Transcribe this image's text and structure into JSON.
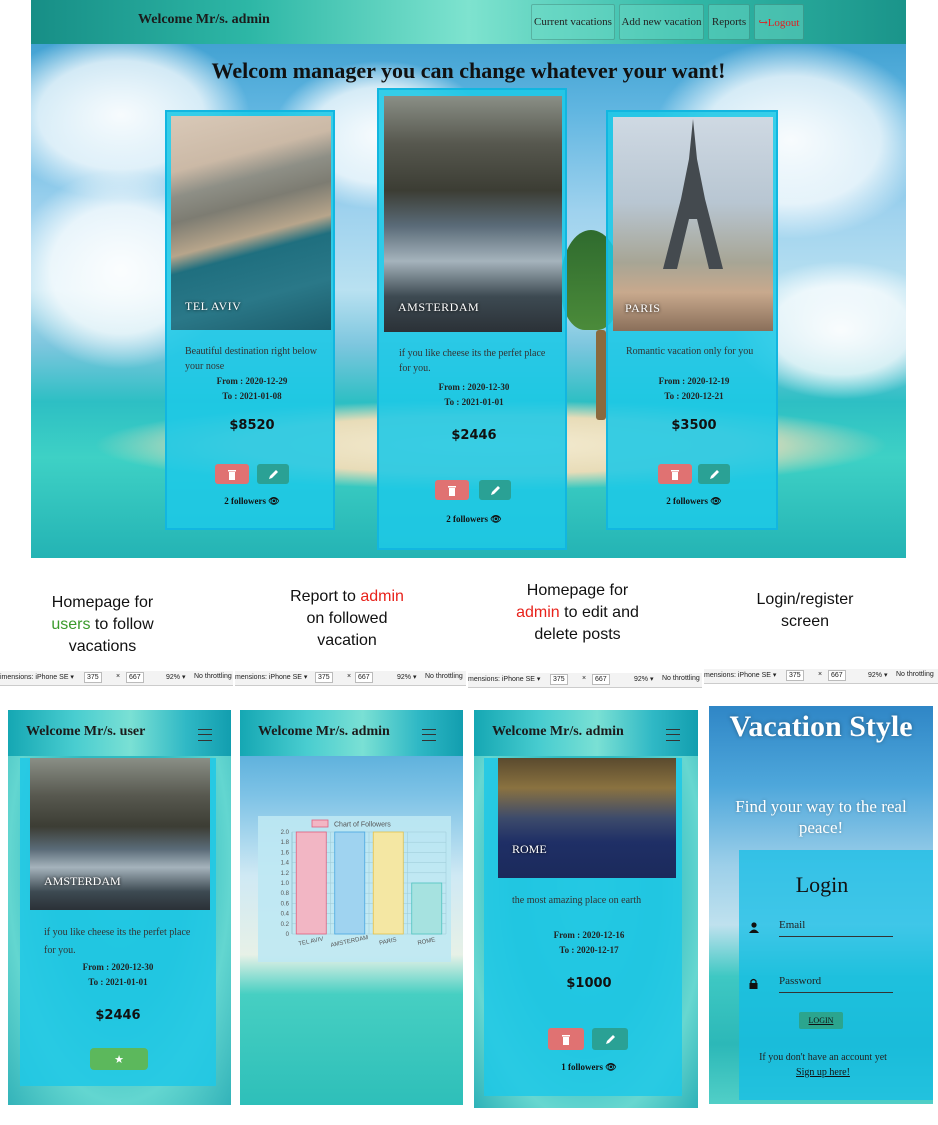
{
  "desktop": {
    "nav": {
      "welcome": "Welcome Mr/s. admin",
      "current_vacations": "Current vacations",
      "add_new_vacation": "Add new vacation",
      "reports": "Reports",
      "logout": "↪Logout"
    },
    "title": "Welcom manager you can change whatever your want!",
    "cards": [
      {
        "place": "TEL AVIV",
        "desc": "Beautiful destination right below your nose",
        "from": "From : 2020-12-29",
        "to": "To : 2021-01-08",
        "price": "$8520",
        "followers": "2 followers 👁"
      },
      {
        "place": "AMSTERDAM",
        "desc": "if you like cheese its the perfet place for you.",
        "from": "From : 2020-12-30",
        "to": "To : 2021-01-01",
        "price": "$2446",
        "followers": "2 followers 👁"
      },
      {
        "place": "PARIS",
        "desc": "Romantic vacation only for you",
        "from": "From : 2020-12-19",
        "to": "To : 2020-12-21",
        "price": "$3500",
        "followers": "2 followers 👁"
      }
    ]
  },
  "captions": {
    "c1_a": "Homepage for",
    "c1_b": "users",
    "c1_c": " to follow",
    "c1_d": "vacations",
    "c2_a": "Report to ",
    "c2_b": "admin",
    "c2_c": "on followed",
    "c2_d": "vacation",
    "c3_a": "Homepage for",
    "c3_b": "admin",
    "c3_c": " to edit and",
    "c3_d": "delete posts",
    "c4_a": "Login/register",
    "c4_b": "screen"
  },
  "devtools": {
    "dim_label": "imensions: iPhone SE ▾",
    "dim_label_alt": "mensions: iPhone SE ▾",
    "width": "375",
    "times": "×",
    "height": "667",
    "zoom": "92% ▾",
    "throttle": "No throttling"
  },
  "mobile_user": {
    "welcome": "Welcome Mr/s. user",
    "place": "AMSTERDAM",
    "desc": "if you like cheese its the perfet place for you.",
    "from": "From : 2020-12-30",
    "to": "To : 2021-01-01",
    "price": "$2446",
    "follow_icon": "★"
  },
  "mobile_report": {
    "welcome": "Welcome Mr/s. admin",
    "chart_data": {
      "type": "bar",
      "legend": "Chart of Followers",
      "categories": [
        "TEL AVIV",
        "AMSTERDAM",
        "PARIS",
        "ROME"
      ],
      "values": [
        2,
        2,
        2,
        1
      ],
      "ylim": [
        0,
        2.0
      ],
      "yticks": [
        "2.0",
        "1.8",
        "1.6",
        "1.4",
        "1.2",
        "1.0",
        "0.8",
        "0.6",
        "0.4",
        "0.2",
        "0"
      ],
      "colors": [
        "#f2b6c4",
        "#9fd3f0",
        "#f4e7a3",
        "#a6e2e0"
      ],
      "borders": [
        "#e0607e",
        "#49a7e0",
        "#e3c14a",
        "#4fc3c0"
      ],
      "grid": true
    }
  },
  "mobile_admin": {
    "welcome": "Welcome Mr/s. admin",
    "place": "ROME",
    "desc": "the most amazing place on earth",
    "from": "From : 2020-12-16",
    "to": "To : 2020-12-17",
    "price": "$1000",
    "followers": "1 followers 👁"
  },
  "mobile_login": {
    "brand": "Vacation Style",
    "tagline": "Find your way to the real peace!",
    "form_title": "Login",
    "email_placeholder": "Email",
    "password_placeholder": "Password",
    "login_button": "LOGIN",
    "register_text": "If you don't have an account yet ",
    "register_link": "Sign up here!"
  },
  "colors": {
    "delete": "#e07272",
    "edit": "#2aa195",
    "card": "#1ec8e6",
    "nav": "#2db7a6"
  }
}
